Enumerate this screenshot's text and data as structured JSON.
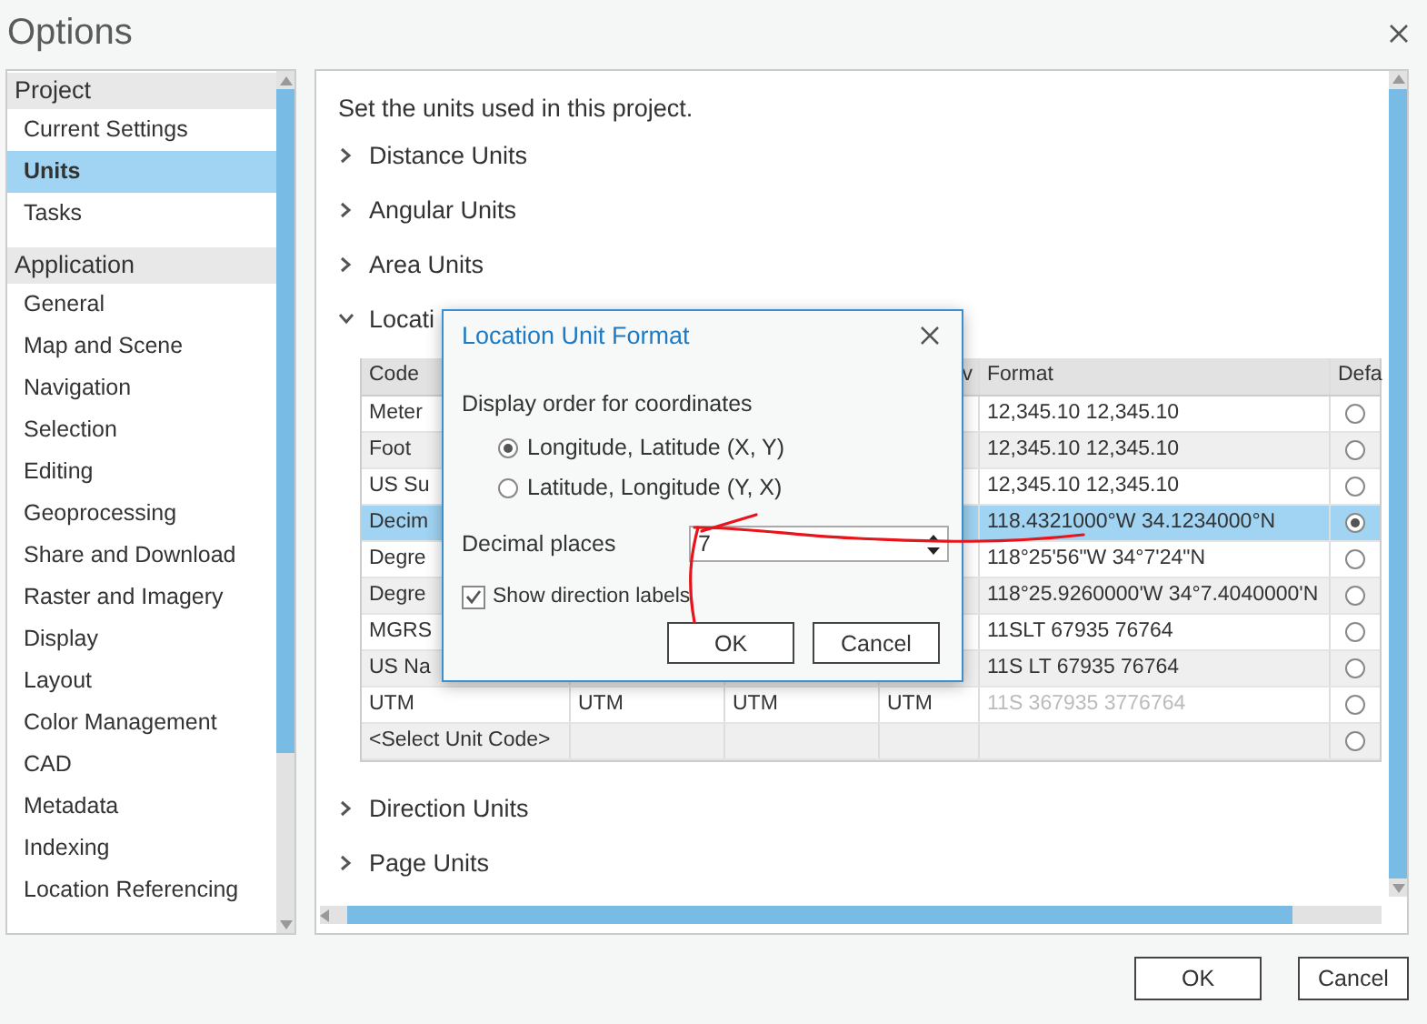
{
  "window": {
    "title": "Options"
  },
  "sidebar": {
    "sections": [
      {
        "header": "Project",
        "items": [
          {
            "label": "Current Settings",
            "selected": false
          },
          {
            "label": "Units",
            "selected": true
          },
          {
            "label": "Tasks",
            "selected": false
          }
        ]
      },
      {
        "header": "Application",
        "items": [
          {
            "label": "General",
            "selected": false
          },
          {
            "label": "Map and Scene",
            "selected": false
          },
          {
            "label": "Navigation",
            "selected": false
          },
          {
            "label": "Selection",
            "selected": false
          },
          {
            "label": "Editing",
            "selected": false
          },
          {
            "label": "Geoprocessing",
            "selected": false
          },
          {
            "label": "Share and Download",
            "selected": false
          },
          {
            "label": "Raster and Imagery",
            "selected": false
          },
          {
            "label": "Display",
            "selected": false
          },
          {
            "label": "Layout",
            "selected": false
          },
          {
            "label": "Color Management",
            "selected": false
          },
          {
            "label": "CAD",
            "selected": false
          },
          {
            "label": "Metadata",
            "selected": false
          },
          {
            "label": "Indexing",
            "selected": false
          },
          {
            "label": "Location Referencing",
            "selected": false
          }
        ]
      }
    ]
  },
  "main": {
    "heading": "Set the units used in this project.",
    "groups": [
      {
        "label": "Distance Units",
        "expanded": false
      },
      {
        "label": "Angular Units",
        "expanded": false
      },
      {
        "label": "Area Units",
        "expanded": false
      },
      {
        "label": "Locati",
        "expanded": true,
        "table": {
          "columns": {
            "code": "Code",
            "column_4": "v",
            "format": "Format",
            "default": "Defa"
          },
          "rows": [
            {
              "code": "Meter",
              "format": "12,345.10 12,345.10",
              "format_dimmed": false,
              "default": false,
              "selected": false
            },
            {
              "code": "Foot",
              "format": "12,345.10 12,345.10",
              "format_dimmed": false,
              "default": false,
              "selected": false
            },
            {
              "code": "US Su",
              "format": "12,345.10 12,345.10",
              "format_dimmed": false,
              "default": false,
              "selected": false
            },
            {
              "code": "Decim",
              "format": "118.4321000°W 34.1234000°N",
              "format_dimmed": false,
              "default": true,
              "selected": true
            },
            {
              "code": "Degre",
              "format": "118°25'56\"W 34°7'24\"N",
              "format_dimmed": false,
              "default": false,
              "selected": false
            },
            {
              "code": "Degre",
              "format": "118°25.9260000'W 34°7.4040000'N",
              "format_dimmed": false,
              "default": false,
              "selected": false
            },
            {
              "code": "MGRS",
              "format": "11SLT 67935 76764",
              "format_dimmed": false,
              "default": false,
              "selected": false
            },
            {
              "code": "US Na",
              "format": "11S LT 67935 76764",
              "format_dimmed": false,
              "default": false,
              "selected": false
            },
            {
              "code": "UTM",
              "column_2": "UTM",
              "column_3": "UTM",
              "column_4": "UTM",
              "format": "11S 367935 3776764",
              "format_dimmed": true,
              "default": false,
              "selected": false
            },
            {
              "code": "<Select Unit Code>",
              "default": false,
              "selected": false
            }
          ]
        }
      },
      {
        "label": "Direction Units",
        "expanded": false
      },
      {
        "label": "Page Units",
        "expanded": false
      }
    ]
  },
  "dialog": {
    "title": "Location Unit Format",
    "order_label": "Display order for coordinates",
    "order_options": [
      {
        "label": "Longitude, Latitude (X, Y)",
        "selected": true
      },
      {
        "label": "Latitude, Longitude (Y, X)",
        "selected": false
      }
    ],
    "decimal_label": "Decimal places",
    "decimal_value": "7",
    "show_labels": {
      "label": "Show direction labels",
      "checked": true
    },
    "buttons": [
      "OK",
      "Cancel"
    ]
  },
  "buttons": [
    "OK",
    "Cancel"
  ]
}
